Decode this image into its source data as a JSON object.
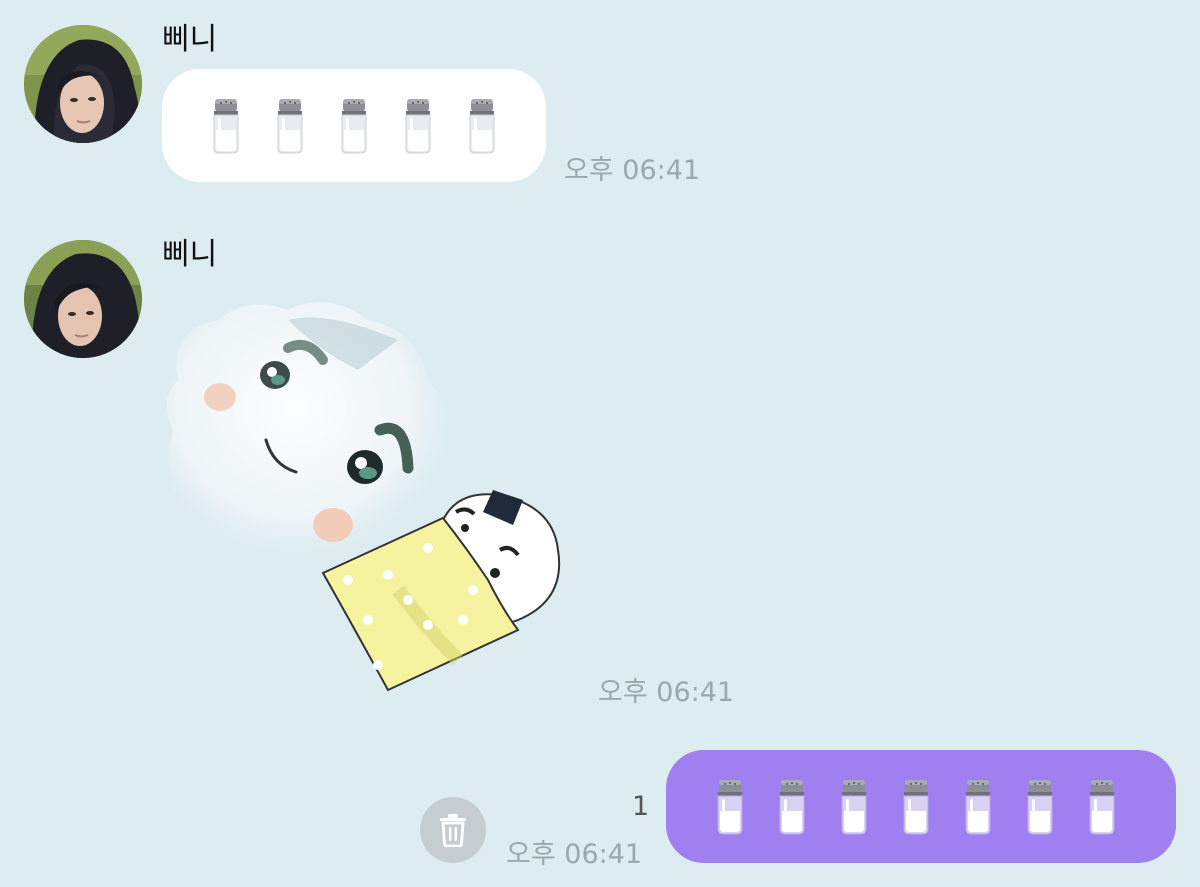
{
  "messages": [
    {
      "sender": "삐니",
      "emoji_count": 5,
      "emoji": "salt-shaker",
      "time": "오후 06:41"
    },
    {
      "sender": "삐니",
      "type": "sticker",
      "sticker": "sleeping-rice-ball-sticker",
      "time": "오후 06:41"
    },
    {
      "outgoing": true,
      "emoji_count": 7,
      "emoji": "salt-shaker",
      "unread": "1",
      "time": "오후 06:41"
    }
  ],
  "colors": {
    "background": "#dcecf1",
    "incoming_bubble": "#ffffff",
    "outgoing_bubble": "#a07ff0",
    "timestamp": "#9aa8ad"
  },
  "icons": {
    "delete": "trash-icon"
  }
}
